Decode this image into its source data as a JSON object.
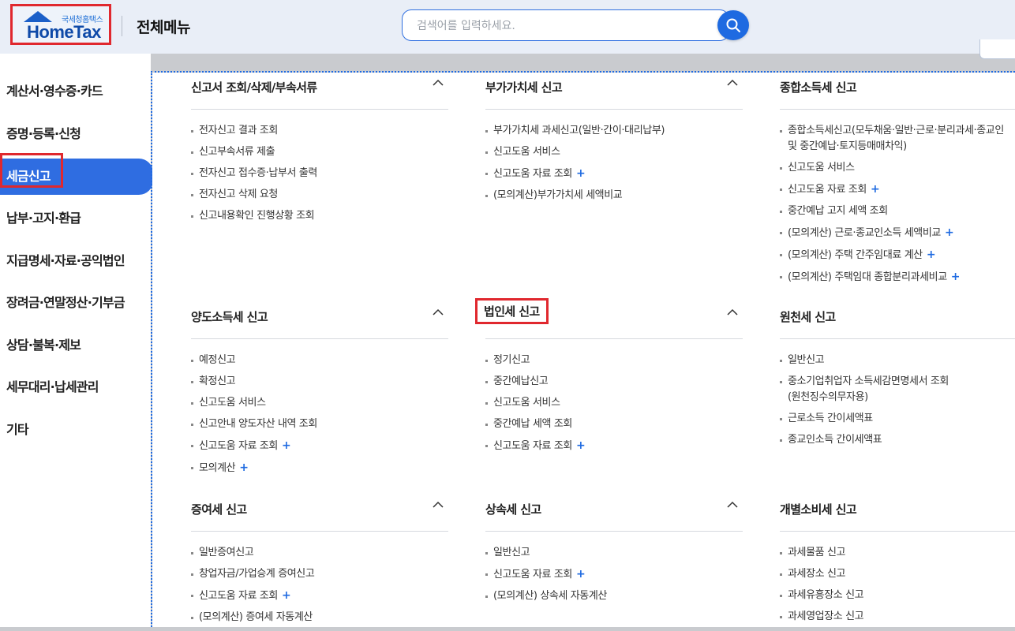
{
  "header": {
    "logo_sub": "국세청홈택스",
    "logo_main": "HomeTax",
    "title": "전체메뉴",
    "search_placeholder": "검색어를 입력하세요."
  },
  "sidebar": {
    "items": [
      {
        "label": "계산서·영수증·카드"
      },
      {
        "label": "증명·등록·신청"
      },
      {
        "label": "세금신고",
        "active": true
      },
      {
        "label": "납부·고지·환급"
      },
      {
        "label": "지급명세·자료·공익법인"
      },
      {
        "label": "장려금·연말정산·기부금"
      },
      {
        "label": "상담·불복·제보"
      },
      {
        "label": "세무대리·납세관리"
      },
      {
        "label": "기타"
      }
    ]
  },
  "sections": [
    {
      "title": "신고서 조회/삭제/부속서류",
      "items": [
        {
          "label": "전자신고 결과 조회"
        },
        {
          "label": "신고부속서류 제출"
        },
        {
          "label": "전자신고 접수증·납부서 출력"
        },
        {
          "label": "전자신고 삭제 요청"
        },
        {
          "label": "신고내용확인 진행상황 조회"
        }
      ]
    },
    {
      "title": "부가가치세 신고",
      "items": [
        {
          "label": "부가가치세 과세신고(일반·간이·대리납부)"
        },
        {
          "label": "신고도움 서비스"
        },
        {
          "label": "신고도움 자료 조회",
          "plus": "+"
        },
        {
          "label": "(모의계산)부가가치세 세액비교"
        }
      ]
    },
    {
      "title": "종합소득세 신고",
      "items": [
        {
          "label": "종합소득세신고(모두채움·일반·근로·분리과세·종교인",
          "label2": "및 중간예납·토지등매매차익)"
        },
        {
          "label": "신고도움 서비스"
        },
        {
          "label": "신고도움 자료 조회",
          "plus": "+"
        },
        {
          "label": "중간예납 고지 세액 조회"
        },
        {
          "label": "(모의계산) 근로·종교인소득 세액비교",
          "plus": "+"
        },
        {
          "label": "(모의계산) 주택 간주임대료 계산",
          "plus": "+"
        },
        {
          "label": "(모의계산) 주택임대 종합분리과세비교",
          "plus": "+"
        }
      ]
    },
    {
      "title": "양도소득세 신고",
      "items": [
        {
          "label": "예정신고"
        },
        {
          "label": "확정신고"
        },
        {
          "label": "신고도움 서비스"
        },
        {
          "label": "신고안내 양도자산 내역 조회"
        },
        {
          "label": "신고도움 자료 조회",
          "plus": "+"
        },
        {
          "label": "모의계산",
          "plus": "+"
        }
      ]
    },
    {
      "title": "법인세 신고",
      "items": [
        {
          "label": "정기신고"
        },
        {
          "label": "중간예납신고"
        },
        {
          "label": "신고도움 서비스"
        },
        {
          "label": "중간예납 세액 조회"
        },
        {
          "label": "신고도움 자료 조회",
          "plus": "+"
        }
      ]
    },
    {
      "title": "원천세 신고",
      "items": [
        {
          "label": "일반신고"
        },
        {
          "label": "중소기업취업자 소득세감면명세서 조회",
          "label2": "(원천징수의무자용)"
        },
        {
          "label": "근로소득 간이세액표"
        },
        {
          "label": "종교인소득 간이세액표"
        }
      ]
    },
    {
      "title": "증여세 신고",
      "items": [
        {
          "label": "일반증여신고"
        },
        {
          "label": "창업자금/가업승계 증여신고"
        },
        {
          "label": "신고도움 자료 조회",
          "plus": "+"
        },
        {
          "label": "(모의계산) 증여세 자동계산"
        }
      ]
    },
    {
      "title": "상속세 신고",
      "items": [
        {
          "label": "일반신고"
        },
        {
          "label": "신고도움 자료 조회",
          "plus": "+"
        },
        {
          "label": "(모의계산) 상속세 자동계산"
        }
      ]
    },
    {
      "title": "개별소비세 신고",
      "items": [
        {
          "label": "과세물품 신고"
        },
        {
          "label": "과세장소 신고"
        },
        {
          "label": "과세유흥장소 신고"
        },
        {
          "label": "과세영업장소 신고"
        }
      ]
    }
  ]
}
